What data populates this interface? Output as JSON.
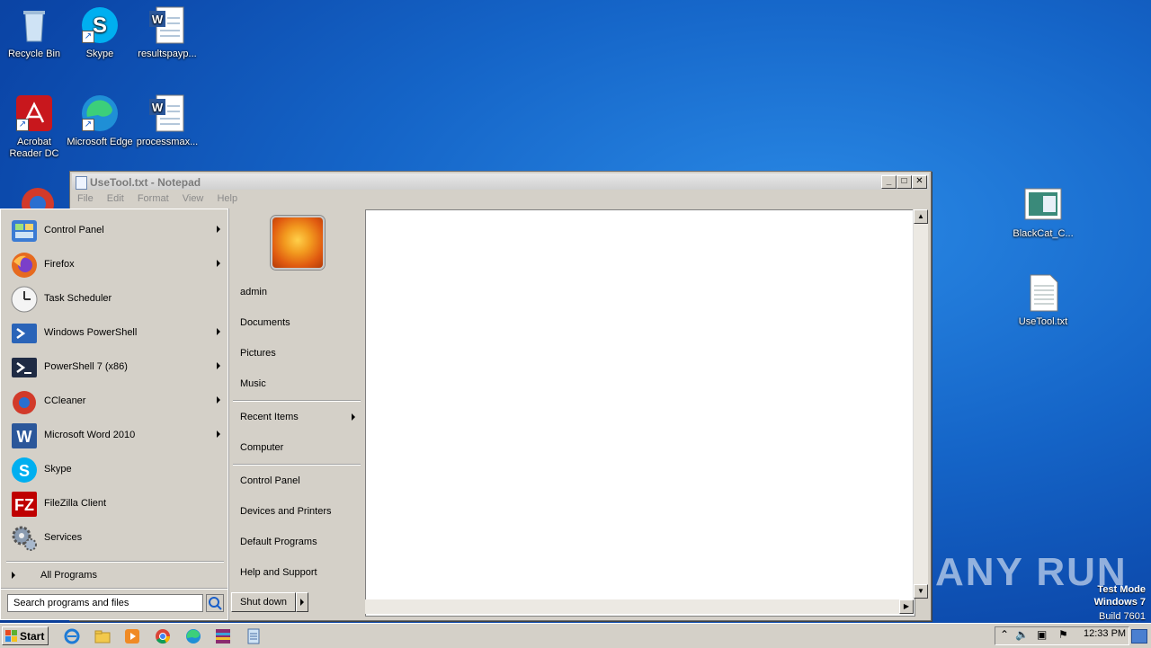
{
  "desktop_icons": [
    {
      "label": "Recycle Bin",
      "icon": "recycle-bin-icon"
    },
    {
      "label": "Skype",
      "icon": "skype-icon"
    },
    {
      "label": "resultspayp...",
      "icon": "word-document-icon"
    },
    {
      "label": "Acrobat Reader DC",
      "icon": "acrobat-icon"
    },
    {
      "label": "Microsoft Edge",
      "icon": "edge-icon"
    },
    {
      "label": "processmax...",
      "icon": "word-document-icon"
    },
    {
      "label": "BlackCat_C...",
      "icon": "image-file-icon"
    },
    {
      "label": "UseTool.txt",
      "icon": "text-file-icon"
    }
  ],
  "notepad": {
    "title": "UseTool.txt - Notepad",
    "menu": [
      "File",
      "Edit",
      "Format",
      "View",
      "Help"
    ],
    "content": ""
  },
  "start_menu": {
    "programs": [
      {
        "label": "Control Panel",
        "arrow": true,
        "color": "#3b7bd4"
      },
      {
        "label": "Firefox",
        "arrow": true,
        "color": "#e66a1f"
      },
      {
        "label": "Task Scheduler",
        "arrow": false,
        "color": "#c8c8c8"
      },
      {
        "label": "Windows PowerShell",
        "arrow": true,
        "color": "#2a64b8"
      },
      {
        "label": "PowerShell 7 (x86)",
        "arrow": true,
        "color": "#1f2b44"
      },
      {
        "label": "CCleaner",
        "arrow": true,
        "color": "#d23a2a"
      },
      {
        "label": "Microsoft Word 2010",
        "arrow": true,
        "color": "#2b579a"
      },
      {
        "label": "Skype",
        "arrow": false,
        "color": "#00aff0"
      },
      {
        "label": "FileZilla Client",
        "arrow": false,
        "color": "#bf0000"
      },
      {
        "label": "Services",
        "arrow": false,
        "color": "#8a9bb0"
      }
    ],
    "all_programs": "All Programs",
    "search_placeholder": "Search programs and files",
    "right_links": [
      "admin",
      "Documents",
      "Pictures",
      "Music",
      "Recent Items",
      "Computer",
      "Control Panel",
      "Devices and Printers",
      "Default Programs",
      "Help and Support"
    ],
    "shutdown": "Shut down"
  },
  "taskbar": {
    "start": "Start",
    "time": "12:33 PM"
  },
  "watermark": "ANY RUN",
  "test_mode": {
    "line1": "Test Mode",
    "line2": "Windows 7",
    "line3": "Build 7601"
  }
}
